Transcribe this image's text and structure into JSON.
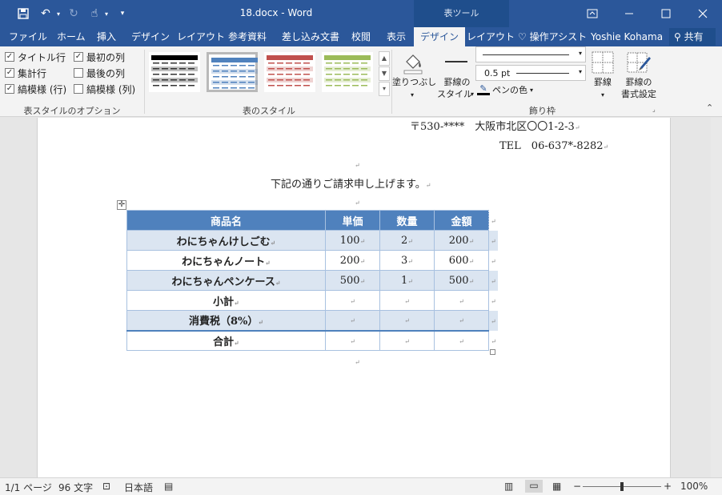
{
  "titlebar": {
    "doc_title": "18.docx - Word",
    "context_group": "表ツール"
  },
  "tabs": [
    "ファイル",
    "ホーム",
    "挿入",
    "デザイン",
    "レイアウト",
    "参考資料",
    "差し込み文書",
    "校閲",
    "表示",
    "デザイン",
    "レイアウト"
  ],
  "active_tab_index": 9,
  "tell_me": "操作アシスト",
  "user_name": "Yoshie Kohama",
  "share_label": "共有",
  "ribbon": {
    "style_options": {
      "items": [
        {
          "label": "タイトル行",
          "checked": true
        },
        {
          "label": "集計行",
          "checked": true
        },
        {
          "label": "縞模様 (行)",
          "checked": true
        },
        {
          "label": "最初の列",
          "checked": true
        },
        {
          "label": "最後の列",
          "checked": false
        },
        {
          "label": "縞模様 (列)",
          "checked": false
        }
      ],
      "group_label": "表スタイルのオプション"
    },
    "table_styles": {
      "group_label": "表のスタイル",
      "thumb_colors": [
        "#000000",
        "#4f81bd",
        "#c0504d",
        "#9bbb59"
      ],
      "selected_index": 1
    },
    "shading_label": "塗りつぶし",
    "borders_group": {
      "border_style_label_1": "罫線の",
      "border_style_label_2": "スタイル",
      "pen_weight": "0.5 pt",
      "pen_color_label": "ペンの色",
      "borders_label": "罫線",
      "painter_label_1": "罫線の",
      "painter_label_2": "書式設定",
      "group_label": "飾り枠"
    }
  },
  "document": {
    "address": "〒530-****　大阪市北区〇〇1-2-3",
    "tel": "TEL　06-637*-8282",
    "intro": "下記の通りご請求申し上げます。",
    "table": {
      "headers": [
        "商品名",
        "単価",
        "数量",
        "金額"
      ],
      "rows": [
        [
          "わにちゃんけしごむ",
          "100",
          "2",
          "200"
        ],
        [
          "わにちゃんノート",
          "200",
          "3",
          "600"
        ],
        [
          "わにちゃんペンケース",
          "500",
          "1",
          "500"
        ],
        [
          "小計",
          "",
          "",
          ""
        ],
        [
          "消費税（8%）",
          "",
          "",
          ""
        ],
        [
          "合計",
          "",
          "",
          ""
        ]
      ]
    }
  },
  "statusbar": {
    "page": "1/1 ページ",
    "words": "96 文字",
    "language": "日本語",
    "zoom": "100%",
    "zoom_level": 100
  }
}
